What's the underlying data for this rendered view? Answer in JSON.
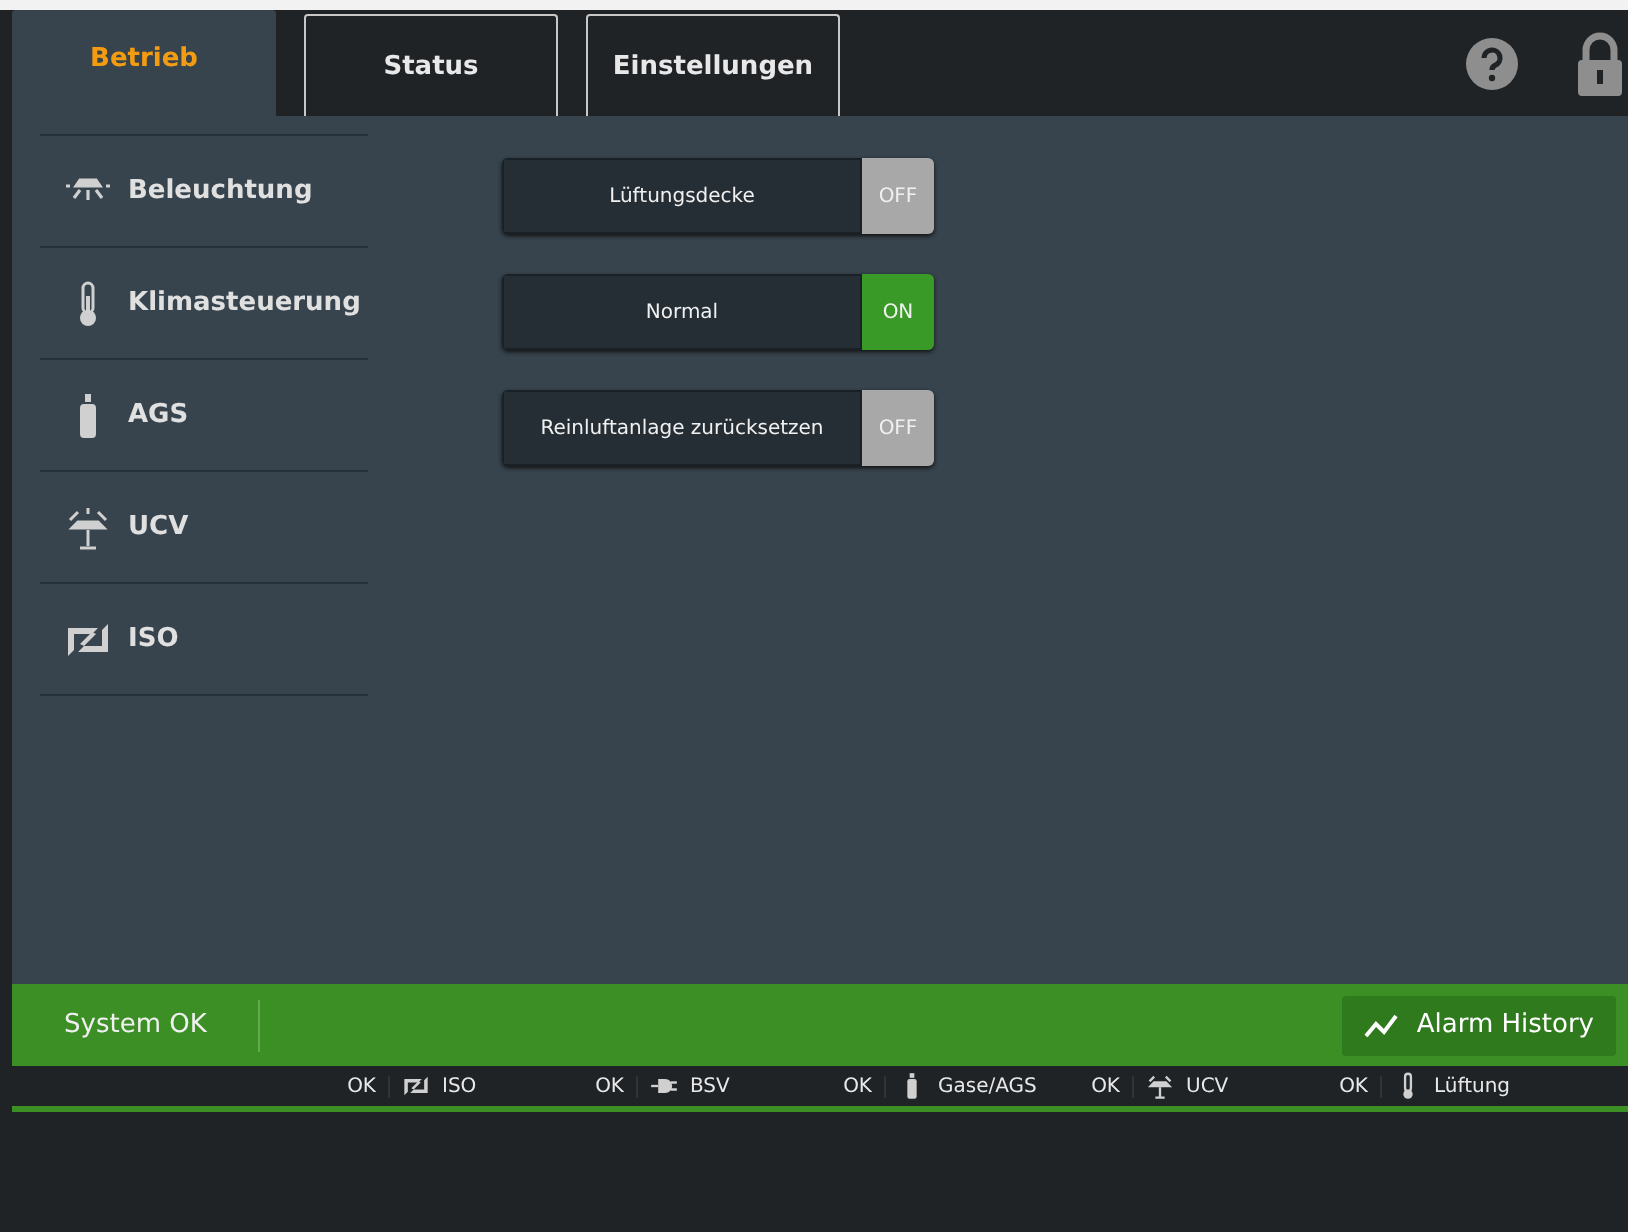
{
  "tabs": [
    {
      "label": "Betrieb",
      "selected": true
    },
    {
      "label": "Status",
      "selected": false
    },
    {
      "label": "Einstellungen",
      "selected": false
    }
  ],
  "sidebar": {
    "items": [
      {
        "label": "Beleuchtung",
        "kind": "lamp"
      },
      {
        "label": "Klimasteuerung",
        "kind": "thermometer"
      },
      {
        "label": "AGS",
        "kind": "bottle"
      },
      {
        "label": "UCV",
        "kind": "ceiling"
      },
      {
        "label": "ISO",
        "kind": "iso"
      }
    ]
  },
  "toggles": [
    {
      "label": "Lüftungsdecke",
      "state": "OFF",
      "on": false
    },
    {
      "label": "Normal",
      "state": "ON",
      "on": true
    },
    {
      "label": "Reinluftanlage zurücksetzen",
      "state": "OFF",
      "on": false
    }
  ],
  "status_bar": {
    "text": "System OK",
    "button": "Alarm History"
  },
  "subsystems": [
    {
      "status": "OK",
      "label": "ISO",
      "kind": "iso"
    },
    {
      "status": "OK",
      "label": "BSV",
      "kind": "plug"
    },
    {
      "status": "OK",
      "label": "Gase/AGS",
      "kind": "bottle"
    },
    {
      "status": "OK",
      "label": "UCV",
      "kind": "ceiling"
    },
    {
      "status": "OK",
      "label": "Lüftung",
      "kind": "thermometer"
    }
  ]
}
